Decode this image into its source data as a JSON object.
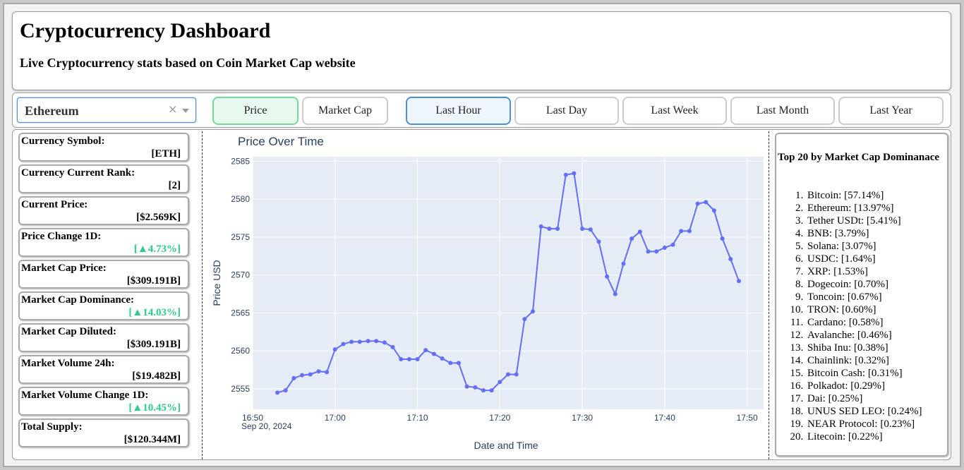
{
  "header": {
    "title": "Cryptocurrency Dashboard",
    "subtitle": "Live Cryptocurrency stats based on Coin Market Cap website"
  },
  "controls": {
    "selected_currency": "Ethereum",
    "clear_glyph": "×",
    "metric_buttons": [
      "Price",
      "Market Cap"
    ],
    "active_metric": "Price",
    "time_buttons": [
      "Last Hour",
      "Last Day",
      "Last Week",
      "Last Month",
      "Last Year"
    ],
    "active_time": "Last Hour"
  },
  "stats": [
    {
      "label": "Currency Symbol:",
      "value": "[ETH]",
      "positive": false
    },
    {
      "label": "Currency Current Rank:",
      "value": "[2]",
      "positive": false
    },
    {
      "label": "Current Price:",
      "value": "[$2.569K]",
      "positive": false
    },
    {
      "label": "Price Change 1D:",
      "value": "[▲4.73%]",
      "positive": true
    },
    {
      "label": "Market Cap Price:",
      "value": "[$309.191B]",
      "positive": false
    },
    {
      "label": "Market Cap Dominance:",
      "value": "[▲14.03%]",
      "positive": true
    },
    {
      "label": "Market Cap Diluted:",
      "value": "[$309.191B]",
      "positive": false
    },
    {
      "label": "Market Volume 24h:",
      "value": "[$19.482B]",
      "positive": false
    },
    {
      "label": "Market Volume Change 1D:",
      "value": "[▲10.45%]",
      "positive": true
    },
    {
      "label": "Total Supply:",
      "value": "[$120.344M]",
      "positive": false
    }
  ],
  "colors": {
    "positive": "#2ecc8a",
    "line": "#636efa",
    "plot_bg": "#e5ecf6"
  },
  "chart_data": {
    "type": "line",
    "title": "Price Over Time",
    "xlabel": "Date and Time",
    "ylabel": "Price USD",
    "date_label": "Sep 20, 2024",
    "x_ticks": [
      "16:50",
      "17:00",
      "17:10",
      "17:20",
      "17:30",
      "17:40",
      "17:50"
    ],
    "y_ticks": [
      2555,
      2560,
      2565,
      2570,
      2575,
      2580,
      2585
    ],
    "ylim": [
      2552.3,
      2585.6
    ],
    "xlim": [
      "16:50",
      "17:52"
    ],
    "grid": true,
    "series": [
      {
        "x": [
          "16:53",
          "16:54",
          "16:55",
          "16:56",
          "16:57",
          "16:58",
          "16:59",
          "17:00",
          "17:01",
          "17:02",
          "17:03",
          "17:04",
          "17:05",
          "17:06",
          "17:07",
          "17:08",
          "17:09",
          "17:10",
          "17:11",
          "17:12",
          "17:13",
          "17:14",
          "17:15",
          "17:16",
          "17:17",
          "17:18",
          "17:19",
          "17:20",
          "17:21",
          "17:22",
          "17:23",
          "17:24",
          "17:25",
          "17:26",
          "17:27",
          "17:28",
          "17:29",
          "17:30",
          "17:31",
          "17:32",
          "17:33",
          "17:34",
          "17:35",
          "17:36",
          "17:37",
          "17:38",
          "17:39",
          "17:40",
          "17:41",
          "17:42",
          "17:43",
          "17:44",
          "17:45",
          "17:46",
          "17:47",
          "17:48",
          "17:49"
        ],
        "values": [
          2554.5,
          2554.8,
          2556.4,
          2556.8,
          2556.9,
          2557.3,
          2557.2,
          2560.2,
          2560.9,
          2561.2,
          2561.2,
          2561.3,
          2561.3,
          2561.1,
          2560.5,
          2558.9,
          2558.9,
          2558.9,
          2560.1,
          2559.6,
          2559.0,
          2558.4,
          2558.4,
          2555.3,
          2555.2,
          2554.8,
          2554.8,
          2555.9,
          2556.9,
          2556.9,
          2564.2,
          2565.2,
          2576.4,
          2576.1,
          2576.1,
          2583.2,
          2583.4,
          2576.1,
          2576.0,
          2574.4,
          2569.8,
          2567.5,
          2571.5,
          2574.8,
          2575.7,
          2573.1,
          2573.1,
          2573.6,
          2574.0,
          2575.8,
          2575.8,
          2579.4,
          2579.6,
          2578.5,
          2574.8,
          2572.1,
          2569.2
        ]
      }
    ]
  },
  "top20": {
    "title": "Top 20 by Market Cap Dominanace",
    "items": [
      "Bitcoin: [57.14%]",
      "Ethereum: [13.97%]",
      "Tether USDt: [5.41%]",
      "BNB: [3.79%]",
      "Solana: [3.07%]",
      "USDC: [1.64%]",
      "XRP: [1.53%]",
      "Dogecoin: [0.70%]",
      "Toncoin: [0.67%]",
      "TRON: [0.60%]",
      "Cardano: [0.58%]",
      "Avalanche: [0.46%]",
      "Shiba Inu: [0.38%]",
      "Chainlink: [0.32%]",
      "Bitcoin Cash: [0.31%]",
      "Polkadot: [0.29%]",
      "Dai: [0.25%]",
      "UNUS SED LEO: [0.24%]",
      "NEAR Protocol: [0.23%]",
      "Litecoin: [0.22%]"
    ]
  }
}
